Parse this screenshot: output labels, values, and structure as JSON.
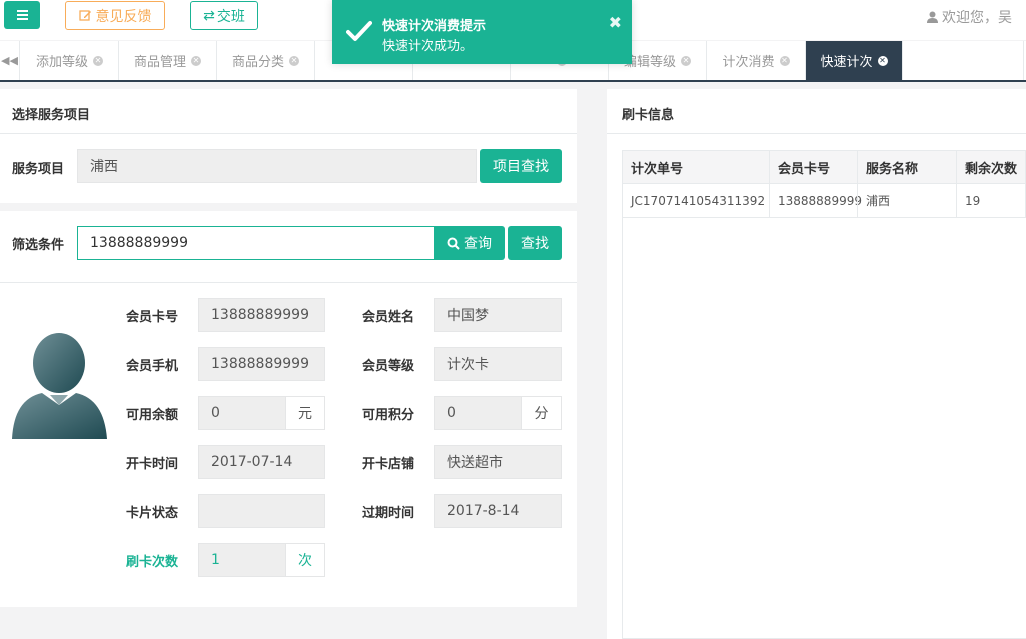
{
  "header": {
    "feedback_label": "意见反馈",
    "shift_label": "交班",
    "welcome": "欢迎您，吴"
  },
  "tabs": [
    {
      "label": "添加等级"
    },
    {
      "label": "商品管理"
    },
    {
      "label": "商品分类"
    },
    {
      "label": ""
    },
    {
      "label": ""
    },
    {
      "label": ""
    },
    {
      "label": "编辑等级"
    },
    {
      "label": "计次消费"
    },
    {
      "label": "快速计次",
      "active": true
    }
  ],
  "toast": {
    "title": "快速计次消费提示",
    "message": "快速计次成功。",
    "close": "✖"
  },
  "service_panel": {
    "title": "选择服务项目",
    "service_label": "服务项目",
    "service_value": "浦西",
    "search_button": "项目查找"
  },
  "filter": {
    "label": "筛选条件",
    "value": "13888889999",
    "query_button": "查询",
    "find_button": "查找"
  },
  "member": {
    "card_no_label": "会员卡号",
    "card_no": "13888889999",
    "name_label": "会员姓名",
    "name": "中国梦",
    "phone_label": "会员手机",
    "phone": "13888889999",
    "level_label": "会员等级",
    "level": "计次卡",
    "balance_label": "可用余额",
    "balance": "0",
    "balance_unit": "元",
    "points_label": "可用积分",
    "points": "0",
    "points_unit": "分",
    "open_time_label": "开卡时间",
    "open_time": "2017-07-14",
    "open_store_label": "开卡店铺",
    "open_store": "快送超市",
    "status_label": "卡片状态",
    "status": "",
    "expire_label": "过期时间",
    "expire": "2017-8-14",
    "swipe_count_label": "刷卡次数",
    "swipe_count": "1",
    "swipe_unit": "次"
  },
  "card_info": {
    "title": "刷卡信息",
    "columns": [
      "计次单号",
      "会员卡号",
      "服务名称",
      "剩余次数"
    ],
    "rows": [
      [
        "JC1707141054311392",
        "13888889999",
        "浦西",
        "19"
      ]
    ]
  },
  "colors": {
    "accent": "#1ab394",
    "warning": "#f8ac59",
    "dark": "#2f4050"
  }
}
